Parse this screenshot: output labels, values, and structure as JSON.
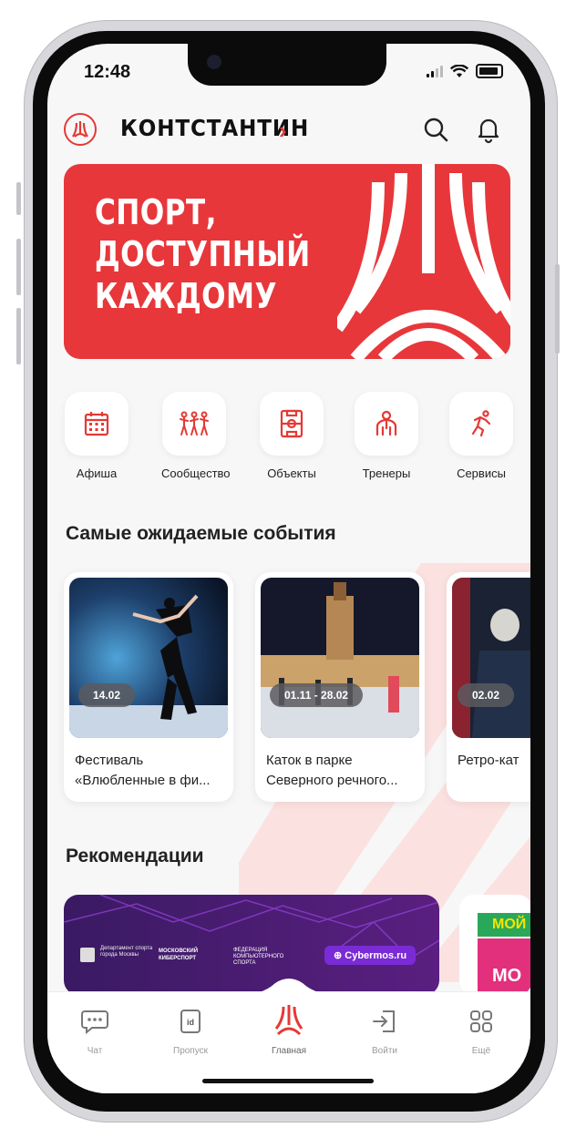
{
  "status": {
    "time": "12:48"
  },
  "header": {
    "user_name": "КОНТСТАНТИН"
  },
  "banner": {
    "line1": "СПОРТ,",
    "line2": "ДОСТУПНЫЙ",
    "line3": "КАЖДОМУ"
  },
  "quick": [
    {
      "label": "Афиша",
      "icon": "calendar-icon"
    },
    {
      "label": "Сообщество",
      "icon": "people-icon"
    },
    {
      "label": "Объекты",
      "icon": "field-icon"
    },
    {
      "label": "Тренеры",
      "icon": "trainer-icon"
    },
    {
      "label": "Сервисы",
      "icon": "runner-icon"
    }
  ],
  "events": {
    "title": "Самые ожидаемые события",
    "items": [
      {
        "date": "14.02",
        "title_line1": "Фестиваль",
        "title_line2": "«Влюбленные в фи..."
      },
      {
        "date": "01.11 - 28.02",
        "title_line1": "Каток в парке",
        "title_line2": "Северного речного..."
      },
      {
        "date": "02.02",
        "title_line1": "Ретро-кат",
        "title_line2": ""
      }
    ]
  },
  "recommendations": {
    "title": "Рекомендации",
    "card1": {
      "org1": "Департамент спорта города Москвы",
      "org2": "МОСКОВСКИЙ КИБЕРСПОРТ",
      "org3": "ФЕДЕРАЦИЯ КОМПЬЮТЕРНОГО СПОРТА",
      "badge": "Cybermos.ru"
    },
    "card2": {
      "top": "МОЙ",
      "bottom": "МО"
    }
  },
  "tabs": [
    {
      "label": "Чат"
    },
    {
      "label": "Пропуск"
    },
    {
      "label": "Главная"
    },
    {
      "label": "Войти"
    },
    {
      "label": "Ещё"
    }
  ],
  "colors": {
    "accent": "#e53935",
    "banner": "#e7373a"
  }
}
